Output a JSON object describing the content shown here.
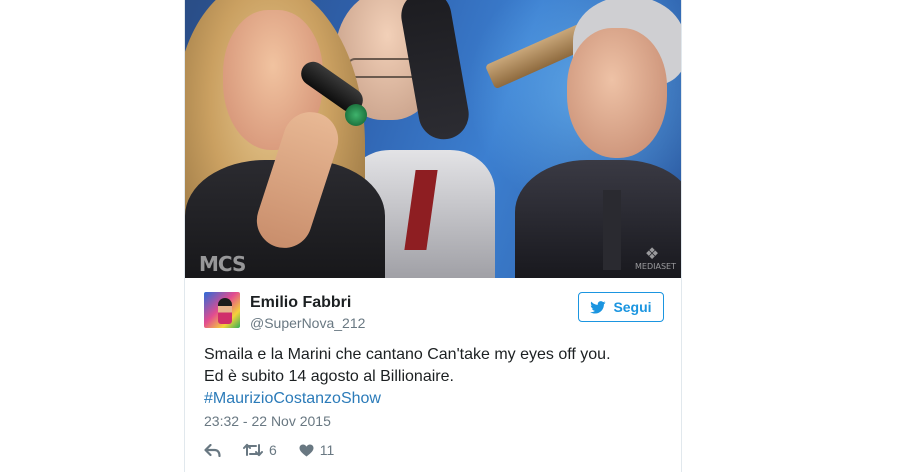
{
  "tweet": {
    "author": {
      "name": "Emilio Fabbri",
      "handle": "@SuperNova_212"
    },
    "follow_button": {
      "label": "Segui"
    },
    "text": {
      "line1": "Smaila e la Marini che cantano Can'take my eyes off you.",
      "line2": "Ed è subito 14 agosto al Billionaire.",
      "hashtag": "#MaurizioCostanzoShow"
    },
    "timestamp": "23:32 - 22 Nov 2015",
    "actions": {
      "retweet_count": "6",
      "like_count": "11"
    },
    "media": {
      "watermark_left": "MCS",
      "watermark_right": "MEDIASET"
    }
  },
  "colors": {
    "link_blue": "#2b7bb9",
    "follow_blue": "#1b95e0",
    "muted_text": "#697882",
    "text": "#1c2022",
    "card_border": "#e1e8ed"
  },
  "icons": {
    "follow": "twitter-bird-icon",
    "reply": "reply-arrow-icon",
    "retweet": "retweet-icon",
    "like": "heart-icon"
  }
}
